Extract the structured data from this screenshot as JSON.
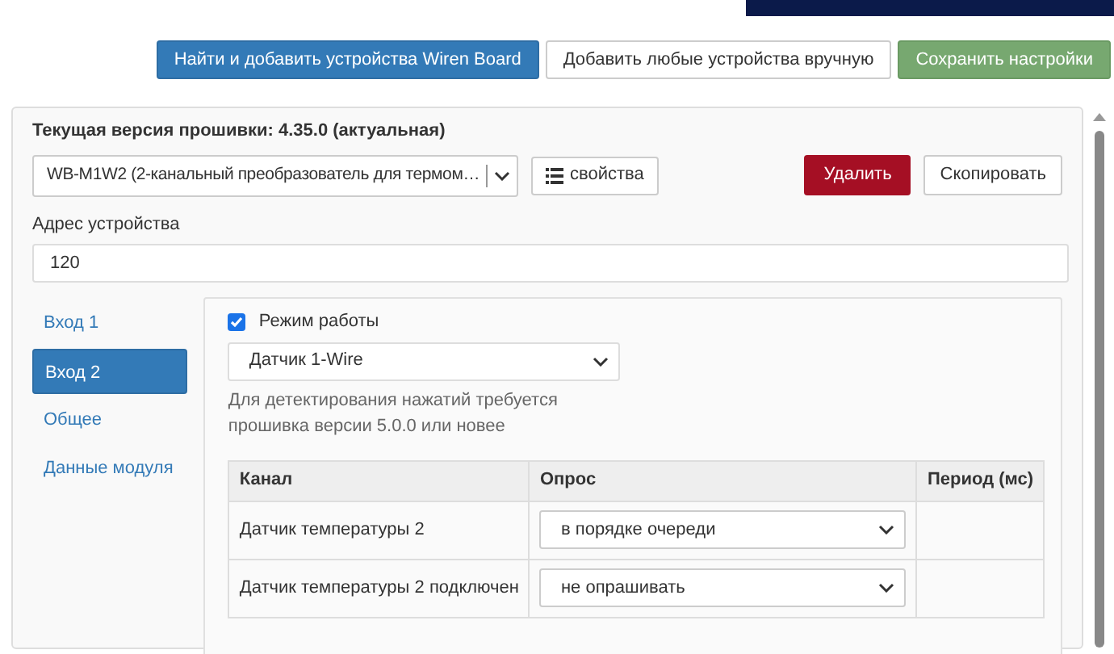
{
  "toolbar": {
    "buttons": [
      {
        "label": "Найти и добавить устройства Wiren Board",
        "kind": "primary"
      },
      {
        "label": "Добавить любые устройства вручную",
        "kind": "default"
      },
      {
        "label": "Сохранить настройки",
        "kind": "success"
      }
    ]
  },
  "device": {
    "firmware": "Текущая версия прошивки: 4.35.0 (актуальная)",
    "type": "WB-M1W2 (2-канальный преобразователь для термом…",
    "properties_button": "свойства",
    "delete_button": "Удалить",
    "copy_button": "Скопировать",
    "address_label": "Адрес устройства",
    "address": "120"
  },
  "sidebar": {
    "items": [
      {
        "label": "Вход 1",
        "selected": false
      },
      {
        "label": "Вход 2",
        "selected": true
      },
      {
        "label": "Общее",
        "selected": false
      },
      {
        "label": "Данные модуля",
        "selected": false
      }
    ]
  },
  "mode": {
    "label": "Режим работы",
    "checked": true,
    "value": "Датчик 1-Wire",
    "help": "Для детектирования нажатий требуется прошивка версии 5.0.0 или новее"
  },
  "table": {
    "columns": [
      "Канал",
      "Опрос",
      "Период (мс)"
    ],
    "rows": [
      {
        "channel": "Датчик температуры 2",
        "poll": "в порядке очереди"
      },
      {
        "channel": "Датчик температуры 2 подключен",
        "poll": "не опрашивать"
      }
    ]
  }
}
